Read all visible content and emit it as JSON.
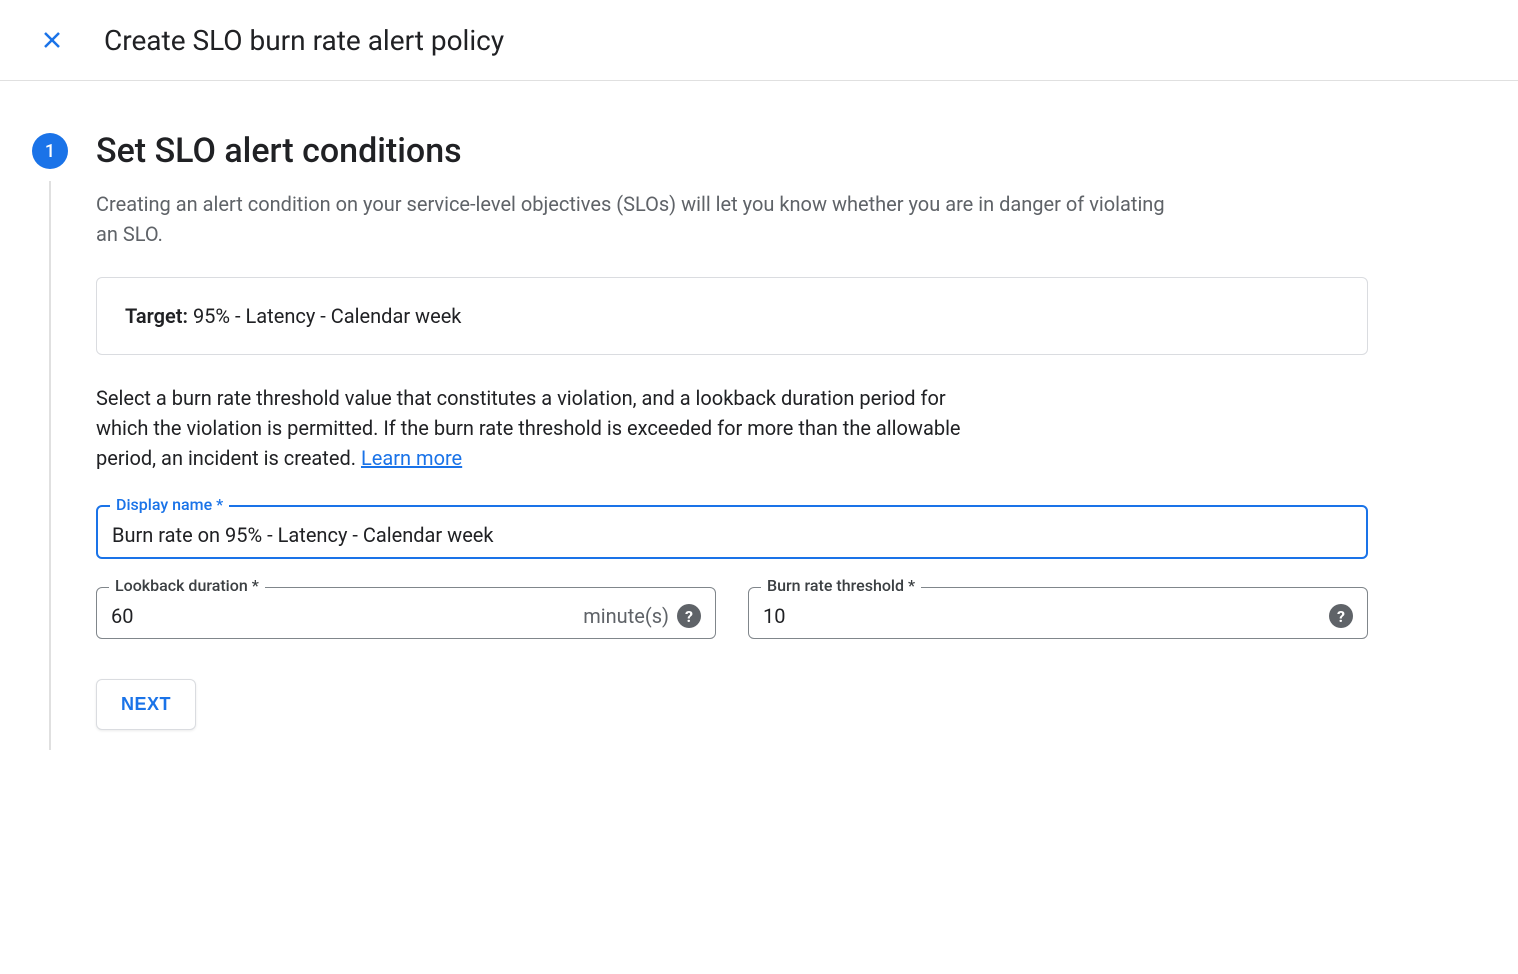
{
  "header": {
    "title": "Create SLO burn rate alert policy"
  },
  "step": {
    "number": "1",
    "title": "Set SLO alert conditions",
    "description": "Creating an alert condition on your service-level objectives (SLOs) will let you know whether you are in danger of violating an SLO.",
    "target_label": "Target:",
    "target_value": " 95% - Latency - Calendar week",
    "instruction": "Select a burn rate threshold value that constitutes a violation, and a lookback duration period for which the violation is permitted. If the burn rate threshold is exceeded for more than the allowable period, an incident is created. ",
    "learn_more": "Learn more"
  },
  "fields": {
    "display_name": {
      "label": "Display name *",
      "value": "Burn rate on 95% - Latency - Calendar week"
    },
    "lookback": {
      "label": "Lookback duration *",
      "value": "60",
      "suffix": "minute(s)"
    },
    "threshold": {
      "label": "Burn rate threshold *",
      "value": "10"
    }
  },
  "buttons": {
    "next": "NEXT"
  }
}
